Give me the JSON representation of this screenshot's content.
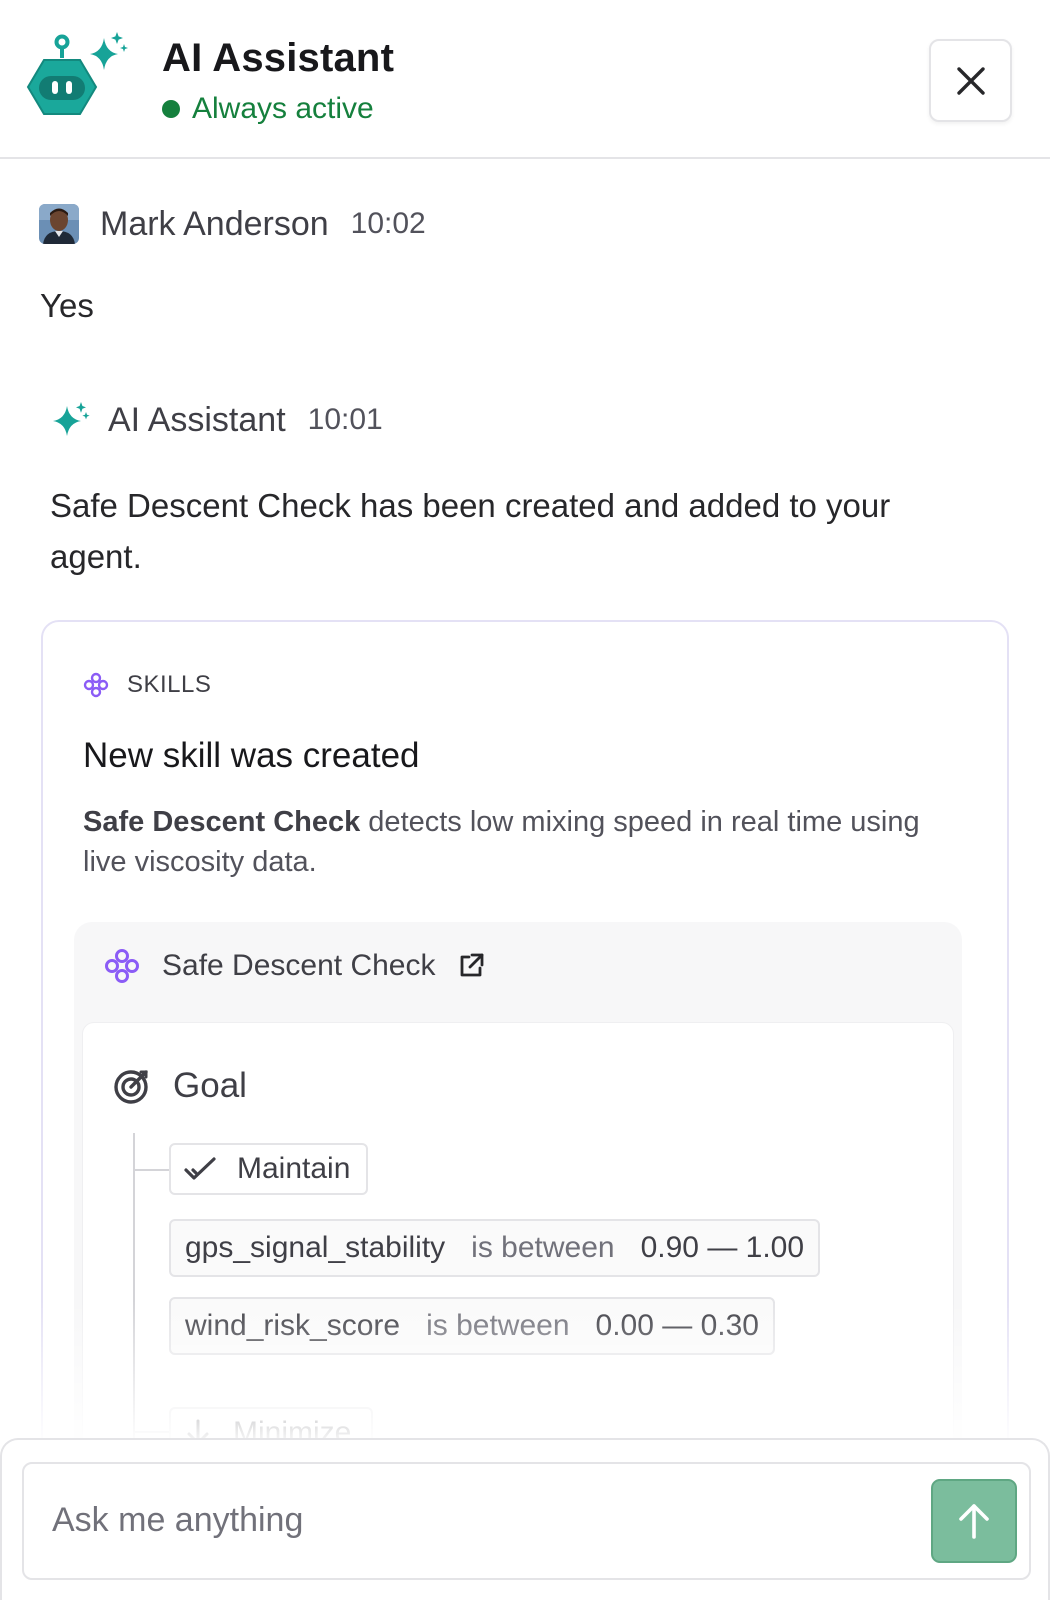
{
  "header": {
    "title": "AI Assistant",
    "status": "Always active",
    "logo_icon": "robot-sparkle-icon",
    "close_icon": "close-icon"
  },
  "messages": [
    {
      "sender": "Mark Anderson",
      "time": "10:02",
      "text": "Yes",
      "avatar_icon": "user-avatar"
    },
    {
      "sender": "AI Assistant",
      "time": "10:01",
      "text": "Safe Descent Check has been created and added to your agent.",
      "avatar_icon": "sparkle-icon"
    }
  ],
  "skill_card": {
    "kicker": "SKILLS",
    "title": "New skill was created",
    "desc_bold": "Safe Descent Check",
    "desc_rest": " detects low mixing speed in real time using live viscosity data.",
    "skill_name": "Safe Descent Check",
    "goal_label": "Goal",
    "maintain_label": "Maintain",
    "conditions": [
      {
        "metric": "gps_signal_stability",
        "op": "is between",
        "range": "0.90 — 1.00"
      },
      {
        "metric": "wind_risk_score",
        "op": "is between",
        "range": "0.00 — 0.30"
      }
    ],
    "minimize_label": "Minimize"
  },
  "composer": {
    "placeholder": "Ask me anything",
    "send_icon": "arrow-up-icon"
  },
  "colors": {
    "accent_teal": "#17a398",
    "status_green": "#15803d",
    "skill_purple": "#8b5cf6",
    "send_green": "#7bbd9d"
  }
}
